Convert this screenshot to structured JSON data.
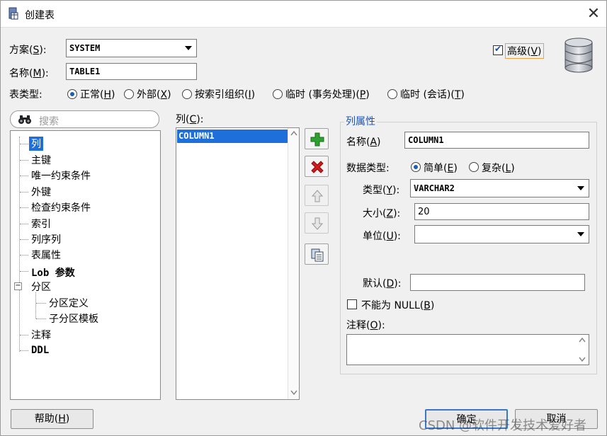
{
  "window": {
    "title": "创建表",
    "close_symbol": "✕"
  },
  "schema": {
    "label": "方案(",
    "key": "S",
    "label_end": "):",
    "value": "SYSTEM"
  },
  "name": {
    "label": "名称(",
    "key": "M",
    "label_end": "):",
    "value": "TABLE1"
  },
  "advanced": {
    "label": "高级(",
    "key": "V",
    "label_end": ")",
    "checked": true
  },
  "table_type": {
    "label": "表类型:",
    "options": [
      {
        "label": "正常(",
        "key": "H",
        "end": ")",
        "selected": true
      },
      {
        "label": "外部(",
        "key": "X",
        "end": ")",
        "selected": false
      },
      {
        "label": "按索引组织(",
        "key": "I",
        "end": ")",
        "selected": false
      },
      {
        "label": "临时 (事务处理)(",
        "key": "P",
        "end": ")",
        "selected": false
      },
      {
        "label": "临时 (会话)(",
        "key": "T",
        "end": ")",
        "selected": false
      }
    ]
  },
  "search": {
    "placeholder": "搜索"
  },
  "tree": {
    "items": [
      "列",
      "主键",
      "唯一约束条件",
      "外键",
      "检查约束条件",
      "索引",
      "列序列",
      "表属性",
      "Lob 参数",
      "分区",
      "分区定义",
      "子分区模板",
      "注释",
      "DDL"
    ],
    "selected": "列",
    "expander": "−"
  },
  "columns": {
    "label": "列(",
    "key": "C",
    "label_end": "):",
    "items": [
      "COLUMN1"
    ]
  },
  "column_props": {
    "title": "列属性",
    "name_label": "名称(",
    "name_key": "A",
    "name_end": ")",
    "name_value": "COLUMN1",
    "datatype_label": "数据类型:",
    "simple_label": "简单(",
    "simple_key": "E",
    "simple_end": ")",
    "complex_label": "复杂(",
    "complex_key": "L",
    "complex_end": ")",
    "type_label": "类型(",
    "type_key": "Y",
    "type_end": "):",
    "type_value": "VARCHAR2",
    "size_label": "大小(",
    "size_key": "Z",
    "size_end": "):",
    "size_value": "20",
    "unit_label": "单位(",
    "unit_key": "U",
    "unit_end": "):",
    "unit_value": "",
    "default_label": "默认(",
    "default_key": "D",
    "default_end": "):",
    "default_value": "",
    "notnull_label": "不能为 NULL(",
    "notnull_key": "B",
    "notnull_end": ")",
    "notnull_checked": false,
    "comment_label": "注释(",
    "comment_key": "O",
    "comment_end": "):",
    "comment_value": ""
  },
  "footer": {
    "help_label": "帮助(",
    "help_key": "H",
    "help_end": ")",
    "ok_label": "确定",
    "cancel_label": "取消"
  },
  "watermark": "CSDN @软件开发技术爱好者",
  "colors": {
    "accent": "#1d55b5",
    "add": "#2ea12e",
    "delete": "#d11a1a",
    "selection": "#1e6fd9"
  }
}
